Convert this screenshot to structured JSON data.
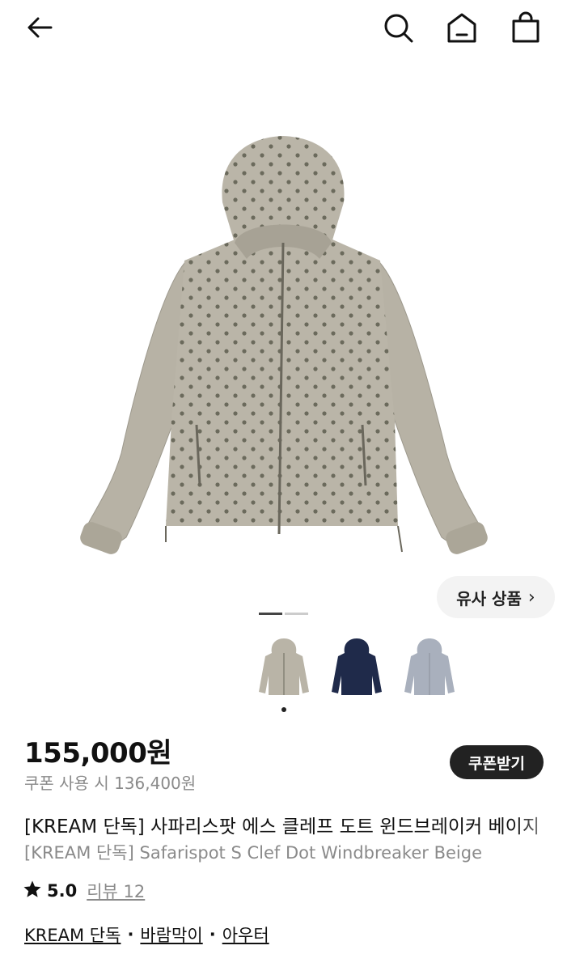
{
  "header": {
    "icons": [
      "back-arrow-icon",
      "search-icon",
      "home-icon",
      "shopping-bag-icon"
    ]
  },
  "gallery": {
    "similar_label": "유사 상품",
    "pages_total": 2,
    "page_current": 1
  },
  "colors": {
    "jacket_beige": "#b9b4a7",
    "dot": "#6b6a5c",
    "navy": "#1f2a4a",
    "grey_blue": "#a9b0bd",
    "button_dark": "#222222"
  },
  "price": {
    "amount": "155,000원",
    "coupon_text": "쿠폰 사용 시 136,400원",
    "coupon_button": "쿠폰받기"
  },
  "product": {
    "title_ko": "[KREAM 단독] 사파리스팟 에스 클레프 도트 윈드브레이커 베이지",
    "title_en": "[KREAM 단독] Safarispot S Clef Dot Windbreaker Beige",
    "rating": "5.0",
    "review_label": "리뷰 12"
  },
  "categories": {
    "items": [
      "KREAM 단독",
      "바람막이",
      "아우터"
    ],
    "separator": "·"
  }
}
